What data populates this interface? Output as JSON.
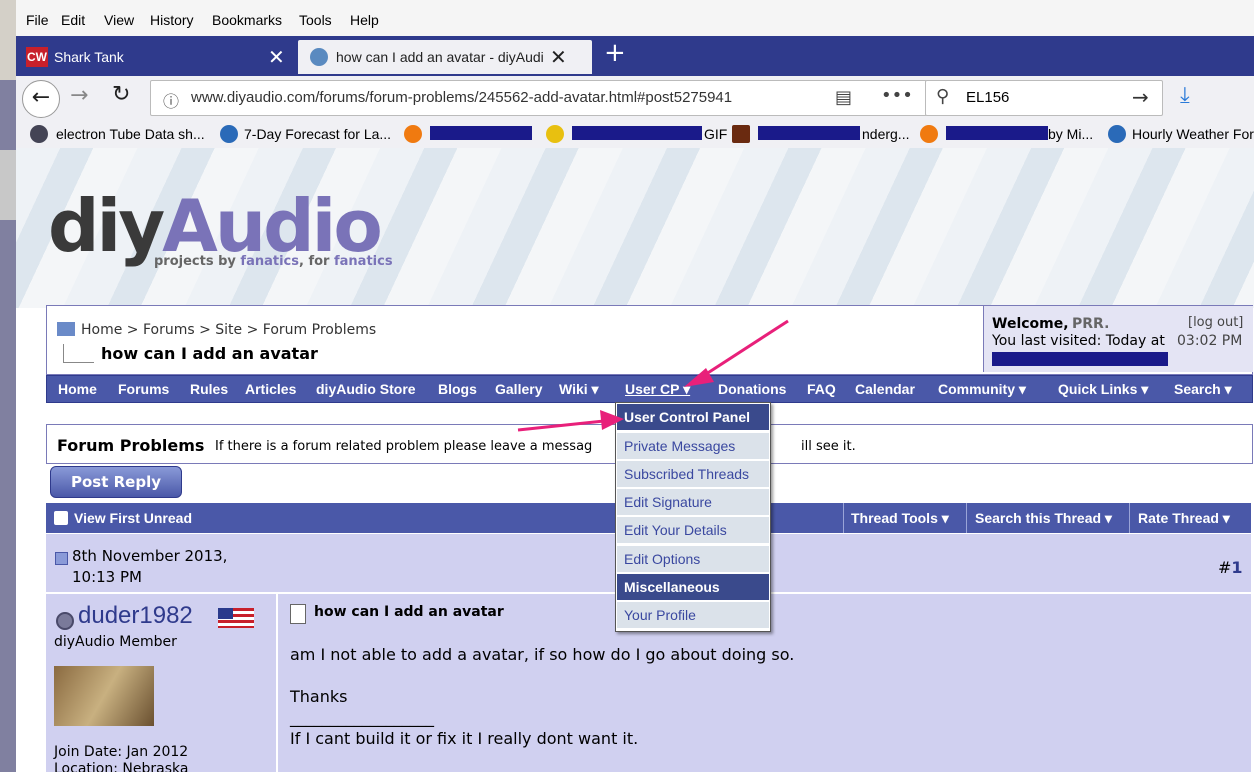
{
  "menubar": [
    "File",
    "Edit",
    "View",
    "History",
    "Bookmarks",
    "Tools",
    "Help"
  ],
  "tabs": [
    {
      "favicon": "CW",
      "title": "Shark Tank"
    },
    {
      "title": "how can I add an avatar - diyAudi"
    }
  ],
  "url": "www.diyaudio.com/forums/forum-problems/245562-add-avatar.html#post5275941",
  "search_value": "EL156",
  "bookmarks": [
    {
      "label": "electron Tube Data sh..."
    },
    {
      "label": "7-Day Forecast for La..."
    },
    {
      "label": "GIF I..."
    },
    {
      "label": "nderg..."
    },
    {
      "label": "by Mi..."
    },
    {
      "label": "Hourly Weather For"
    }
  ],
  "site": {
    "logo_diy": "diy",
    "logo_audio": "Audio",
    "tagline_a": "projects by ",
    "tagline_b": "fanatics",
    "tagline_c": ", for ",
    "tagline_d": "fanatics"
  },
  "breadcrumb": "Home > Forums > Site > Forum Problems",
  "thread_title": "how can I add an avatar",
  "welcome": {
    "label": "Welcome,",
    "user": "PRR.",
    "logout": "[log out]",
    "visited_label": "You last visited: Today at",
    "visited_time": "03:02 PM"
  },
  "nav": [
    "Home",
    "Forums",
    "Rules",
    "Articles",
    "diyAudio Store",
    "Blogs",
    "Gallery",
    "Wiki ▾",
    "User CP ▾",
    "Donations",
    "FAQ",
    "Calendar",
    "Community ▾",
    "Quick Links ▾",
    "Search ▾"
  ],
  "forum": {
    "name": "Forum Problems",
    "desc": "If there is a forum related problem please leave a messag",
    "desc_tail": "ill see it."
  },
  "post_reply": "Post Reply",
  "thread_tools": {
    "first_unread": "View First Unread",
    "tools": "Thread Tools ▾",
    "search": "Search this Thread ▾",
    "rate": "Rate Thread ▾"
  },
  "post": {
    "date_line1": "8th November 2013,",
    "date_line2": "10:13 PM",
    "number_prefix": "#",
    "number": "1",
    "username": "duder1982",
    "user_title": "diyAudio Member",
    "join_date": "Join Date: Jan 2012",
    "location": "Location: Nebraska",
    "title": "how can I add an avatar",
    "body_line1": "am I not able to add a avatar, if so how do I go about doing so.",
    "body_line2": "Thanks",
    "sig_rule": "__________________",
    "signature": "If I cant build it or fix it I really dont want it."
  },
  "dropdown": [
    {
      "label": "User Control Panel",
      "header": true
    },
    {
      "label": "Private Messages"
    },
    {
      "label": "Subscribed Threads"
    },
    {
      "label": "Edit Signature"
    },
    {
      "label": "Edit Your Details"
    },
    {
      "label": "Edit Options"
    },
    {
      "label": "Miscellaneous",
      "header": true
    },
    {
      "label": "Your Profile"
    }
  ],
  "colors": {
    "accent": "#4a58a8",
    "tabbar": "#2f3a8c",
    "annotation": "#e8207a",
    "redaction": "#1a1a8a"
  }
}
